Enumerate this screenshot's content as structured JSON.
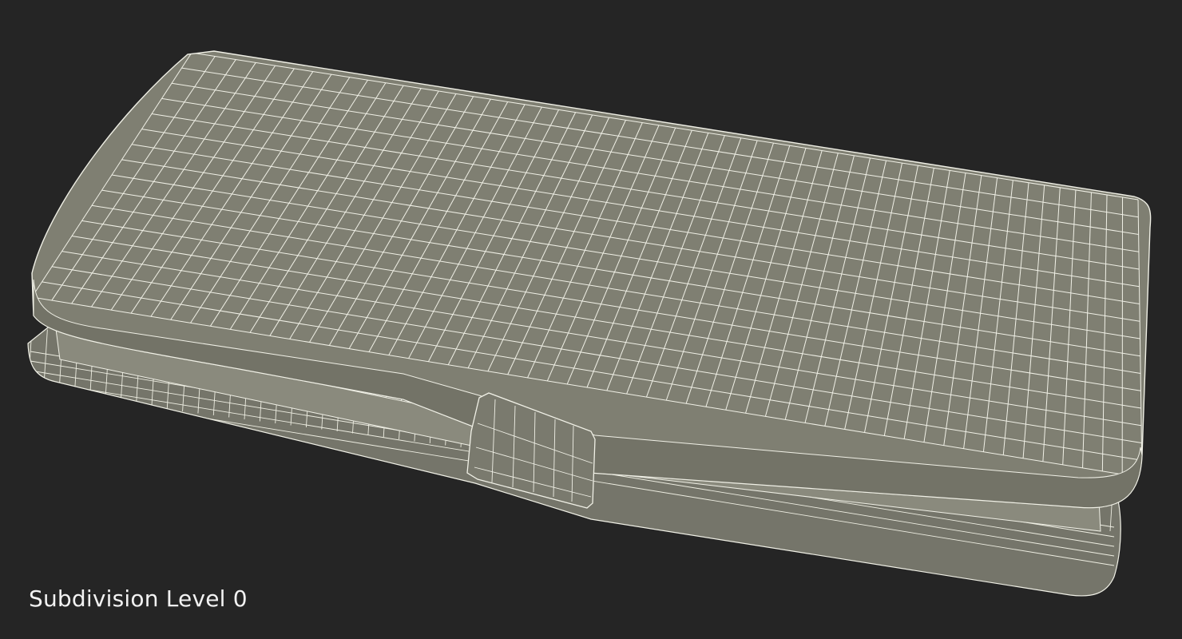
{
  "caption": "Subdivision Level 0",
  "colors": {
    "background": "#252525",
    "surface": "#7f7f72",
    "surface_shade": "#6e6e62",
    "wire": "#f0f0e6",
    "caption": "#f2f2f2"
  }
}
